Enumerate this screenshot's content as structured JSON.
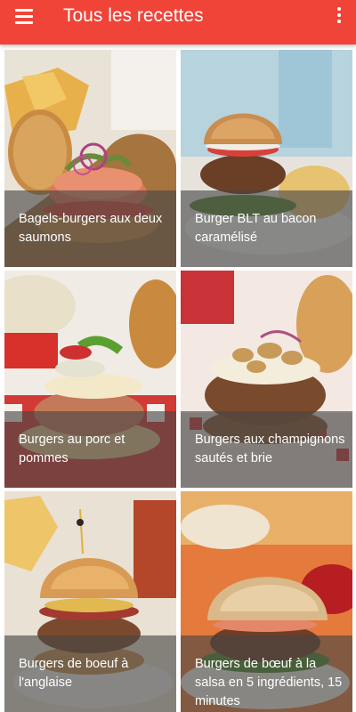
{
  "app_bar": {
    "title": "Tous les recettes",
    "menu_icon": "hamburger-menu-icon",
    "overflow_icon": "more-vert-icon",
    "color": "#f04438"
  },
  "recipes": [
    {
      "title": "Bagels-burgers aux deux saumons"
    },
    {
      "title": "Burger BLT au bacon caramélisé"
    },
    {
      "title": "Burgers au porc et pommes"
    },
    {
      "title": "Burgers aux champignons sautés et brie"
    },
    {
      "title": "Burgers de boeuf à l'anglaise"
    },
    {
      "title": "Burgers de bœuf à la salsa en 5 ingrédients, 15 minutes"
    }
  ]
}
